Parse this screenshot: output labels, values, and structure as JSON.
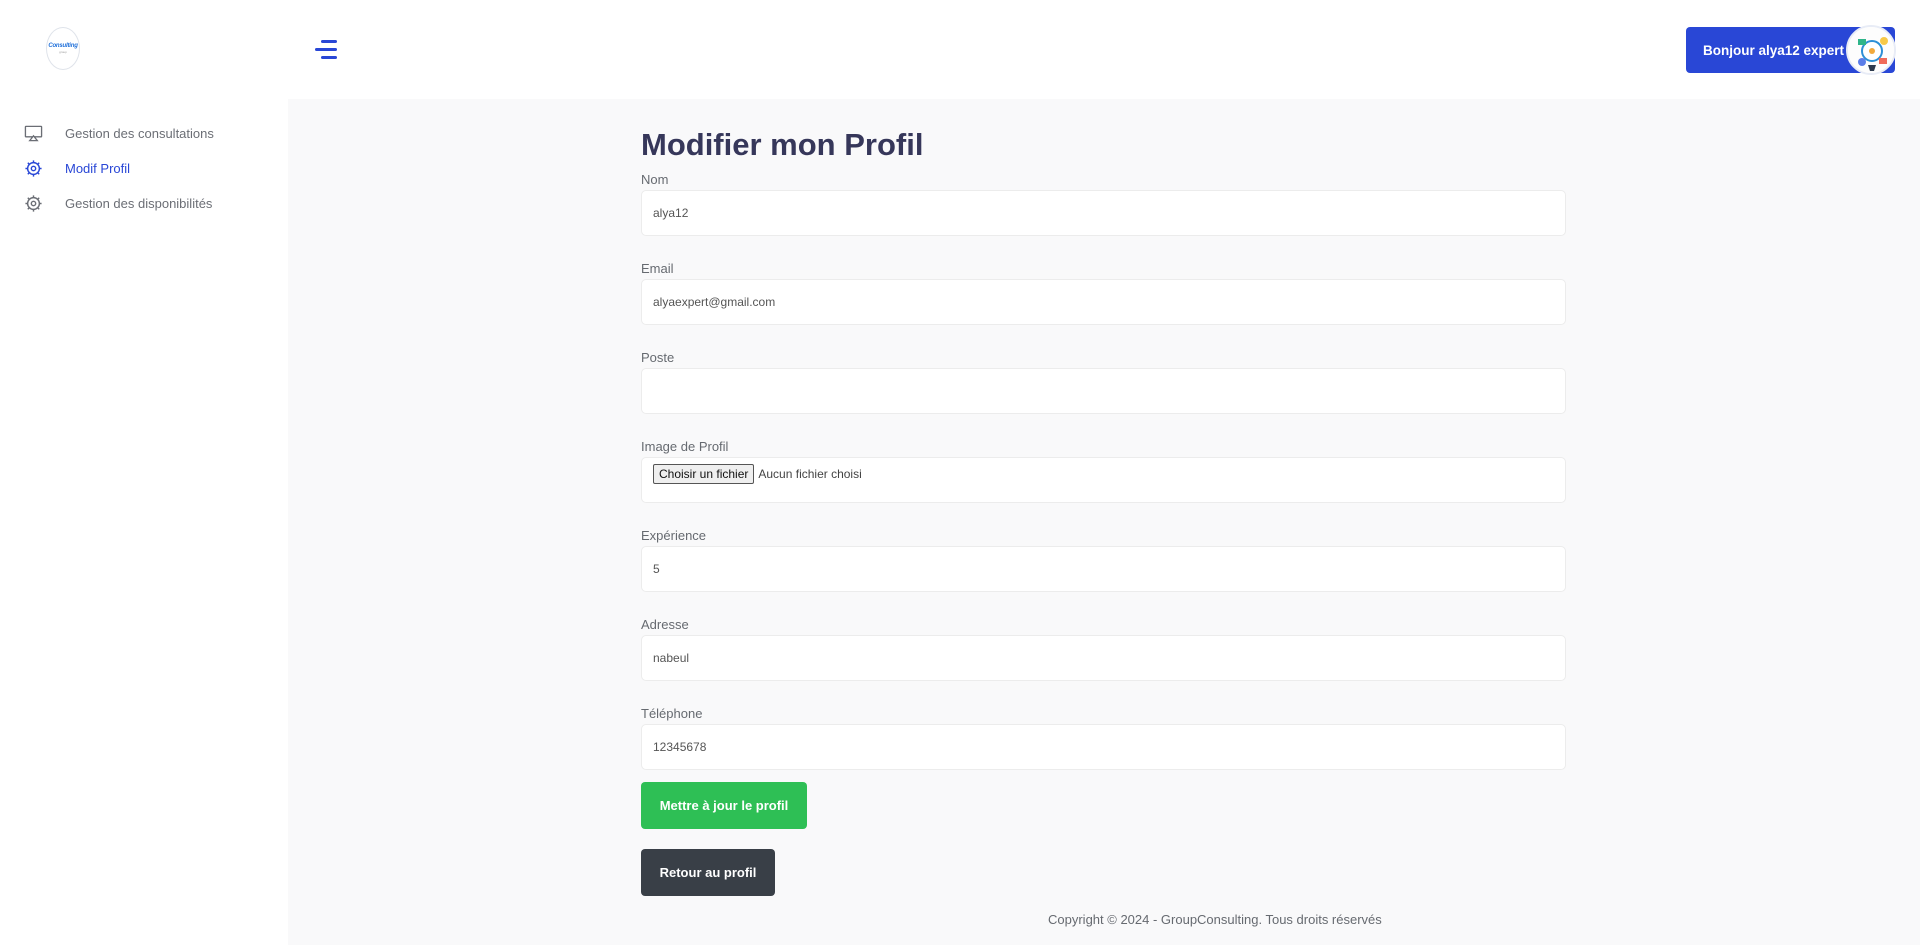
{
  "logo": {
    "text": "Consulting",
    "sub": "group"
  },
  "sidebar": {
    "items": [
      {
        "label": "Gestion des consultations",
        "icon": "monitor-icon",
        "active": false
      },
      {
        "label": "Modif Profil",
        "icon": "gear-icon",
        "active": true
      },
      {
        "label": "Gestion des disponibilités",
        "icon": "gear-icon",
        "active": false
      }
    ]
  },
  "header": {
    "menu_icon": "menu-icon",
    "greeting": "Bonjour alya12 expert"
  },
  "form": {
    "title": "Modifier mon Profil",
    "nom": {
      "label": "Nom",
      "value": "alya12"
    },
    "email": {
      "label": "Email",
      "value": "alyaexpert@gmail.com"
    },
    "poste": {
      "label": "Poste",
      "value": ""
    },
    "image": {
      "label": "Image de Profil",
      "button": "Choisir un fichier",
      "status": "Aucun fichier choisi"
    },
    "experience": {
      "label": "Expérience",
      "value": "5"
    },
    "adresse": {
      "label": "Adresse",
      "value": "nabeul"
    },
    "telephone": {
      "label": "Téléphone",
      "value": "12345678"
    },
    "update_button": "Mettre à jour le profil",
    "back_button": "Retour au profil"
  },
  "footer": {
    "text": "Copyright © 2024 - GroupConsulting. Tous droits réservés"
  },
  "colors": {
    "accent": "#2947d6",
    "success": "#2ebf55",
    "dark": "#393f47",
    "title": "#36375a"
  }
}
